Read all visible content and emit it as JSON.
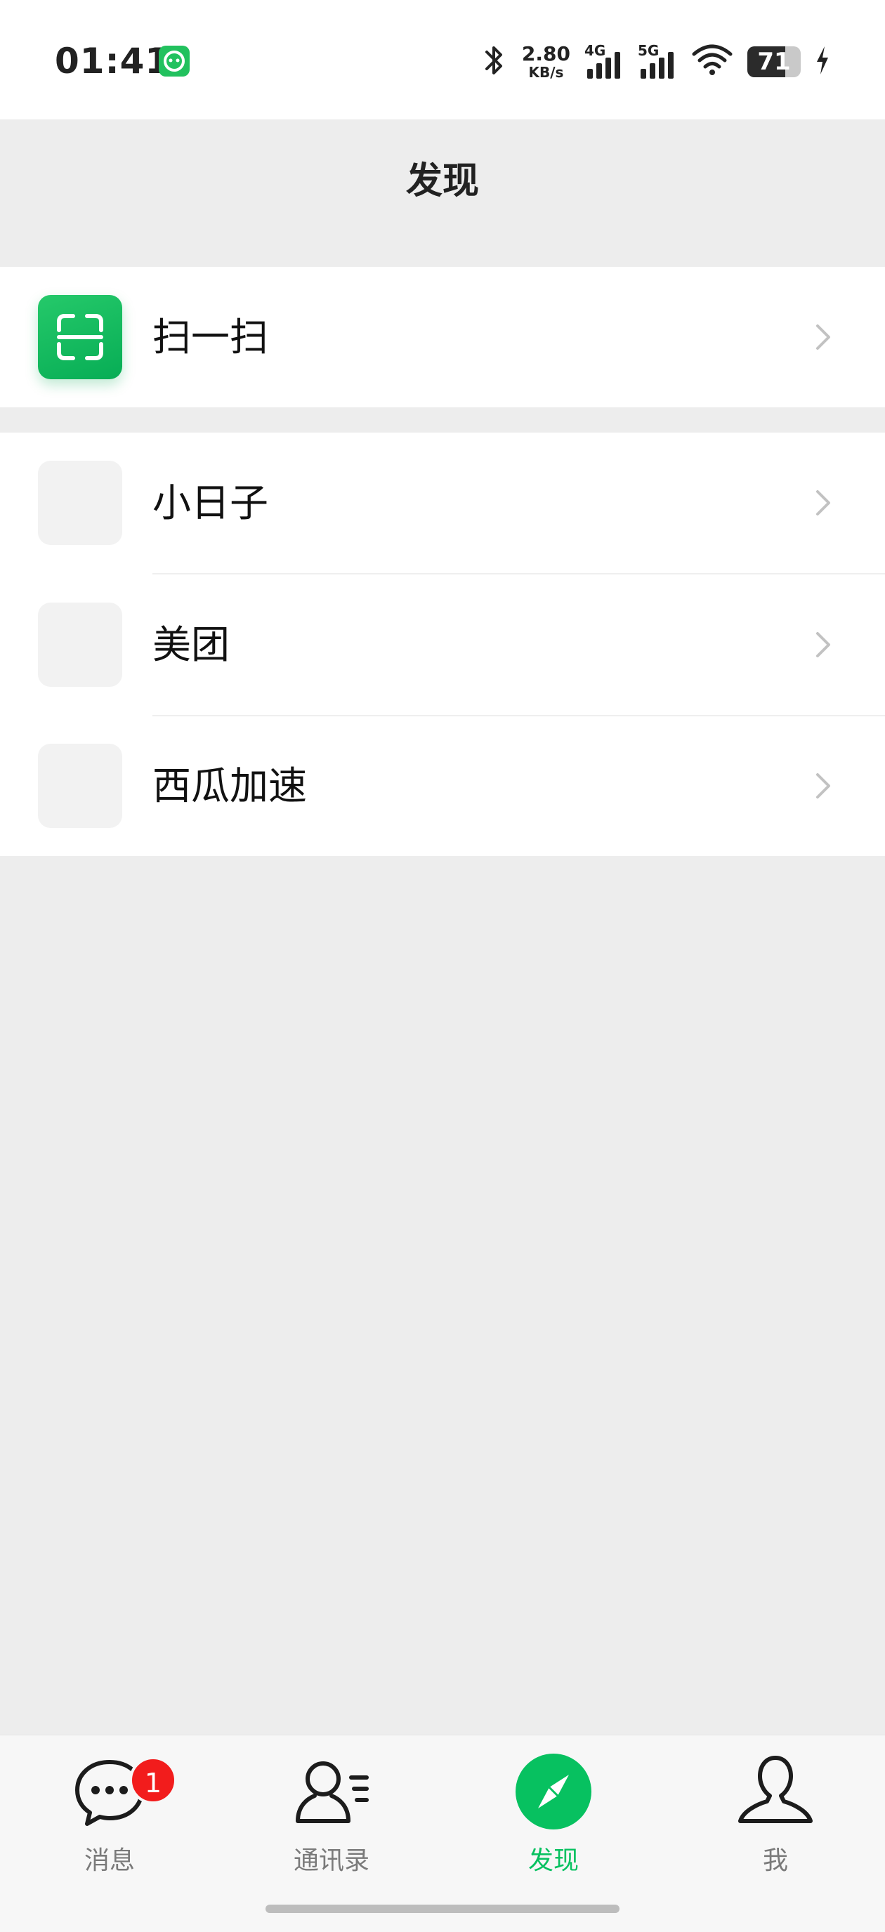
{
  "status_bar": {
    "time": "01:41",
    "net_speed_value": "2.80",
    "net_speed_unit": "KB/s",
    "network_1": "4G",
    "network_2": "5G",
    "battery_level": "71",
    "battery_fraction": 0.71
  },
  "header": {
    "title": "发现"
  },
  "groups": [
    {
      "items": [
        {
          "label": "扫一扫",
          "icon": "scan-icon"
        }
      ]
    },
    {
      "items": [
        {
          "label": "小日子",
          "icon": "placeholder-icon"
        },
        {
          "label": "美团",
          "icon": "placeholder-icon"
        },
        {
          "label": "西瓜加速",
          "icon": "placeholder-icon"
        }
      ]
    }
  ],
  "tab_bar": {
    "tabs": [
      {
        "label": "消息",
        "icon": "chat-bubble-icon",
        "badge": "1",
        "active": false
      },
      {
        "label": "通讯录",
        "icon": "contacts-icon",
        "active": false
      },
      {
        "label": "发现",
        "icon": "compass-icon",
        "active": true
      },
      {
        "label": "我",
        "icon": "person-icon",
        "active": false
      }
    ]
  },
  "colors": {
    "accent": "#07c160",
    "background": "#ededed",
    "badge": "#f21c1c"
  }
}
